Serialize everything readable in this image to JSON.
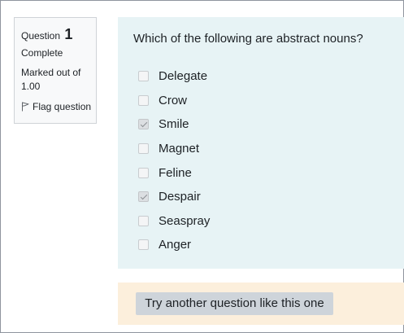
{
  "info": {
    "question_label": "Question",
    "question_number": "1",
    "state": "Complete",
    "marked_out_of": "Marked out of 1.00",
    "flag_label": "Flag question"
  },
  "question": {
    "text": "Which of the following are abstract nouns?",
    "options": [
      {
        "label": "Delegate",
        "checked": false
      },
      {
        "label": "Crow",
        "checked": false
      },
      {
        "label": "Smile",
        "checked": true
      },
      {
        "label": "Magnet",
        "checked": false
      },
      {
        "label": "Feline",
        "checked": false
      },
      {
        "label": "Despair",
        "checked": true
      },
      {
        "label": "Seaspray",
        "checked": false
      },
      {
        "label": "Anger",
        "checked": false
      }
    ]
  },
  "actions": {
    "try_another_label": "Try another question like this one"
  },
  "colors": {
    "question_bg": "#e7f3f5",
    "feedback_bg": "#fcefdc",
    "button_bg": "#ced4da",
    "info_bg": "#f8f9fa"
  }
}
